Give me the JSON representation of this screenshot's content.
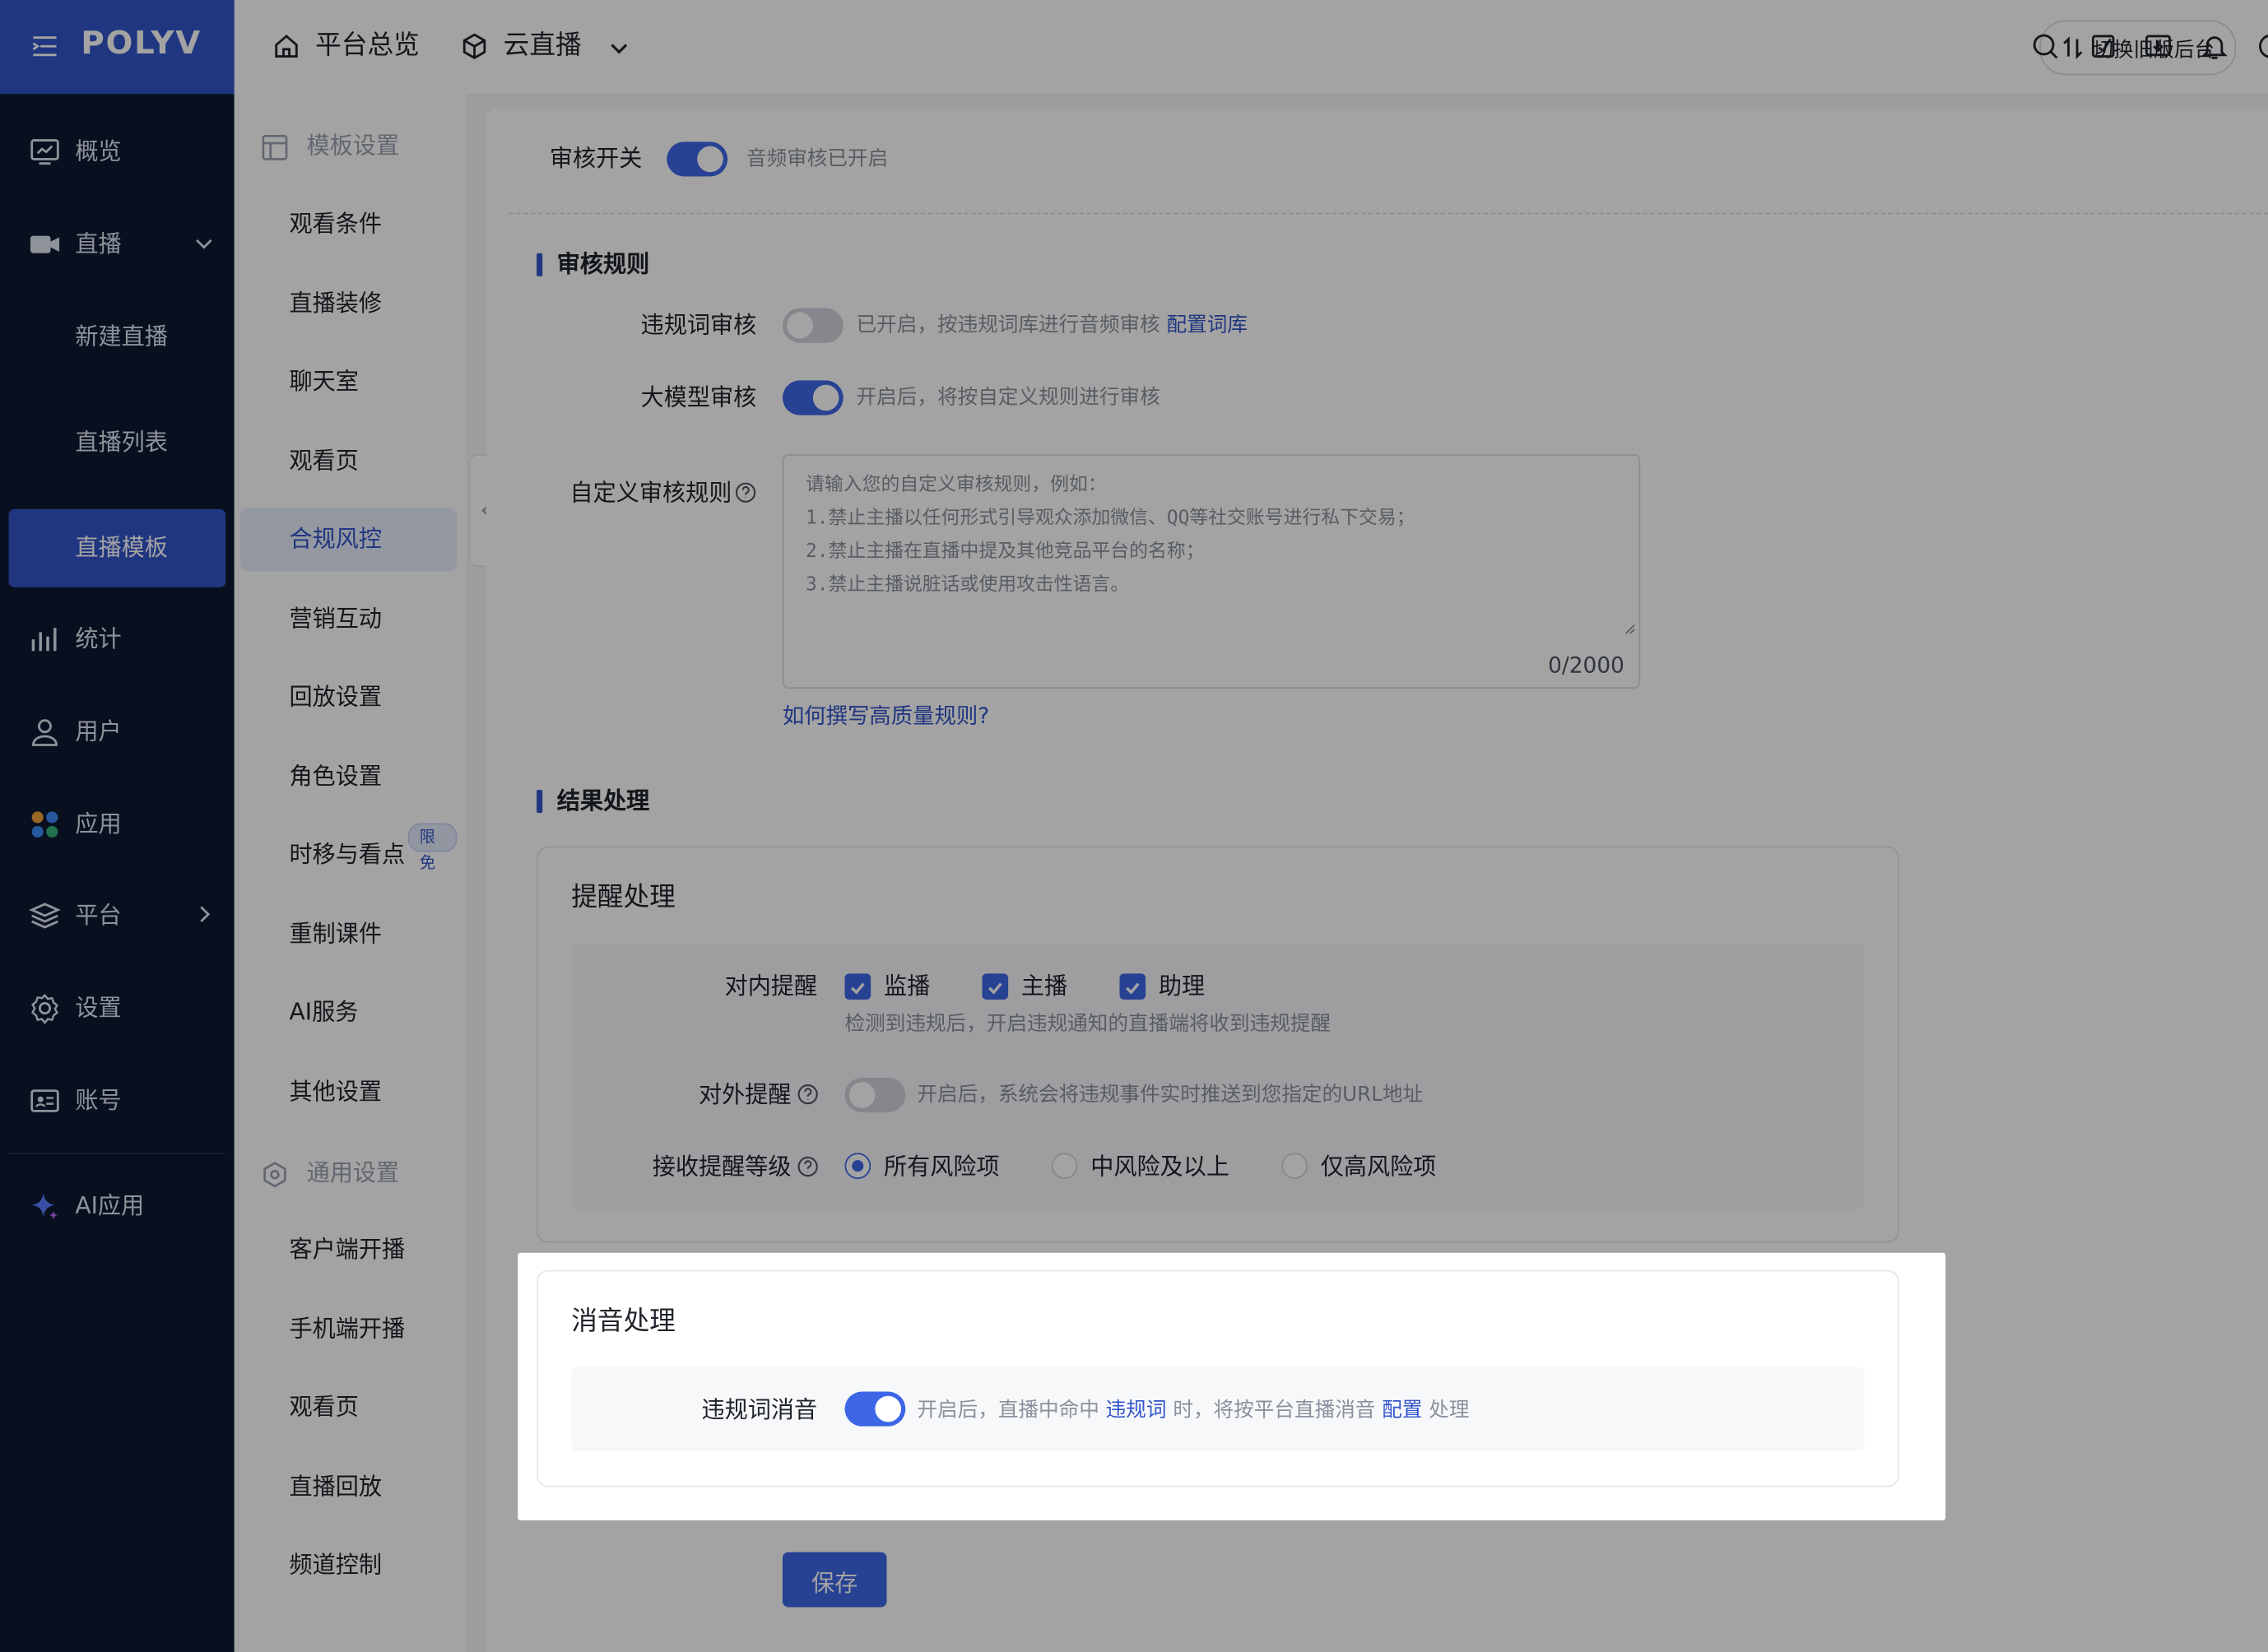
{
  "brand": "POLYV",
  "nav": {
    "overview": "概览",
    "live": "直播",
    "live_sub": [
      "新建直播",
      "直播列表",
      "直播模板"
    ],
    "stats": "统计",
    "users": "用户",
    "apps": "应用",
    "platform": "平台",
    "settings": "设置",
    "account": "账号",
    "ai_apps": "AI应用"
  },
  "header": {
    "overview_tab": "平台总览",
    "product_tab": "云直播",
    "switch_button": "切换旧版后台"
  },
  "sub_sidebar": {
    "template_group": "模板设置",
    "template_items": [
      "观看条件",
      "直播装修",
      "聊天室",
      "观看页",
      "合规风控",
      "营销互动",
      "回放设置",
      "角色设置",
      "时移与看点",
      "重制课件",
      "AI服务",
      "其他设置"
    ],
    "badge": "限免",
    "general_group": "通用设置",
    "general_items": [
      "客户端开播",
      "手机端开播",
      "观看页",
      "直播回放",
      "频道控制"
    ]
  },
  "audit": {
    "switch_label": "审核开关",
    "switch_on": true,
    "switch_hint": "音频审核已开启",
    "rules_title": "审核规则",
    "word_audit_label": "违规词审核",
    "word_audit_on": false,
    "word_audit_hint": "已开启，按违规词库进行音频审核",
    "word_audit_link": "配置词库",
    "llm_audit_label": "大模型审核",
    "llm_audit_on": true,
    "llm_audit_hint": "开启后，将按自定义规则进行审核",
    "custom_rules_label": "自定义审核规则",
    "custom_rules_placeholder": [
      "请输入您的自定义审核规则，例如：",
      "1.禁止主播以任何形式引导观众添加微信、QQ等社交账号进行私下交易；",
      "2.禁止主播在直播中提及其他竞品平台的名称；",
      "3.禁止主播说脏话或使用攻击性语言。"
    ],
    "custom_rules_counter": "0/2000",
    "how_to_link": "如何撰写高质量规则?"
  },
  "result": {
    "title": "结果处理",
    "remind_card_title": "提醒处理",
    "internal_label": "对内提醒",
    "internal_options": [
      "监播",
      "主播",
      "助理"
    ],
    "internal_hint": "检测到违规后，开启违规通知的直播端将收到违规提醒",
    "external_label": "对外提醒",
    "external_on": false,
    "external_hint": "开启后，系统会将违规事件实时推送到您指定的URL地址",
    "level_label": "接收提醒等级",
    "level_options": [
      "所有风险项",
      "中风险及以上",
      "仅高风险项"
    ],
    "level_selected": "所有风险项",
    "mute_card_title": "消音处理",
    "mute_label": "违规词消音",
    "mute_on": true,
    "mute_hint_1": "开启后，直播中命中",
    "mute_link_1": "违规词",
    "mute_hint_2": "时，将按平台直播消音",
    "mute_link_2": "配置",
    "mute_hint_3": "处理"
  },
  "save_button": "保存",
  "colors": {
    "primary": "#3d66e6",
    "nav_bg": "#0e1a33",
    "logo_bg": "#3255c9"
  }
}
